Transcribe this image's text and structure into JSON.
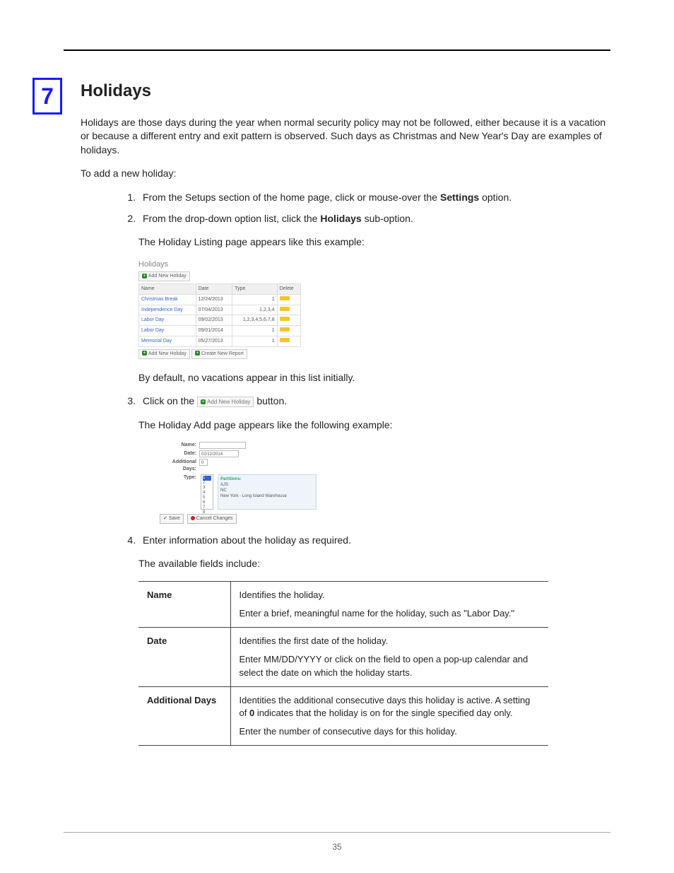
{
  "chapter_number": "7",
  "heading": "Holidays",
  "intro": "Holidays are those days during the year when normal security policy may not be followed, either because it is a vacation or because a different entry and exit pattern is observed. Such days as Christmas and New Year's Day are examples of holidays.",
  "to_add": "To add a new holiday:",
  "steps": {
    "s1_pre": "From the Setups section of the home page, click or mouse-over the ",
    "s1_bold": "Settings",
    "s1_post": " option.",
    "s2_pre": "From the drop-down option list, click the ",
    "s2_bold": "Holidays",
    "s2_post": " sub-option.",
    "s2_after": "The Holiday Listing page appears like this example:",
    "s2_default": "By default, no vacations appear in this list initially.",
    "s3_pre": "Click on the ",
    "s3_post": " button.",
    "s3_after": "The Holiday Add page appears like the following example:",
    "s4": "Enter information about the holiday as required.",
    "s4_after": "The available fields include:"
  },
  "fig1": {
    "title": "Holidays",
    "add_btn": "Add New Holiday",
    "create_report_btn": "Create New Report",
    "headers": {
      "name": "Name",
      "date": "Date",
      "type": "Type",
      "delete": "Delete"
    },
    "rows": [
      {
        "name": "Christmas Break",
        "date": "12/24/2013",
        "type": "1"
      },
      {
        "name": "Independence Day",
        "date": "07/04/2013",
        "type": "1,2,3,4"
      },
      {
        "name": "Labor Day",
        "date": "09/02/2013",
        "type": "1,2,3,4,5,6,7,8"
      },
      {
        "name": "Labor Day",
        "date": "09/01/2014",
        "type": "1"
      },
      {
        "name": "Memorial Day",
        "date": "05/27/2013",
        "type": "1"
      }
    ]
  },
  "inline_btn_label": "Add New Holiday",
  "fig2": {
    "labels": {
      "name": "Name:",
      "date": "Date:",
      "additional_days": "Additional Days:",
      "type": "Type:",
      "partitions": "Partitions:"
    },
    "date_value": "02/12/2014",
    "additional_days_value": "0",
    "type_options": [
      "1",
      "2",
      "3",
      "4",
      "5",
      "6",
      "7",
      "8"
    ],
    "partitions_options": [
      "AJS",
      "NC",
      "New York - Long Island Warehouse"
    ],
    "save": "Save",
    "cancel": "Cancel Changes"
  },
  "fields_table": [
    {
      "name": "Name",
      "desc": [
        "Identifies the holiday.",
        "Enter a brief, meaningful name for the holiday, such as \"Labor Day.\""
      ]
    },
    {
      "name": "Date",
      "desc": [
        "Identifies the first date of the holiday.",
        "Enter MM/DD/YYYY or click on the field to open a pop-up calendar and select the date on which the holiday starts."
      ]
    },
    {
      "name": "Additional Days",
      "desc": [
        "Identities the additional consecutive days this holiday is active. A setting of 0 indicates that the holiday is on for the single specified day only.",
        "Enter the number of consecutive days for this holiday."
      ]
    }
  ],
  "page_number": "35"
}
